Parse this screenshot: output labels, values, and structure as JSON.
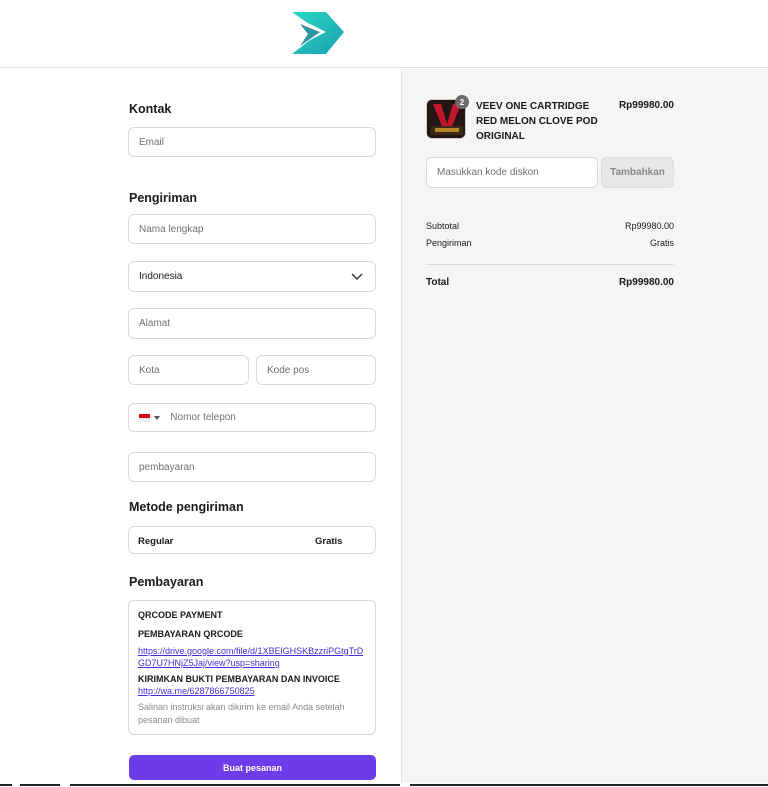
{
  "contact": {
    "title": "Kontak",
    "email_placeholder": "Email"
  },
  "shipping": {
    "title": "Pengiriman",
    "fullname_placeholder": "Nama lengkap",
    "country": "Indonesia",
    "address_placeholder": "Alamat",
    "city_placeholder": "Kota",
    "postal_placeholder": "Kode pos",
    "phone_placeholder": "Nomor telepon",
    "payment_field_placeholder": "pembayaran"
  },
  "shipping_method": {
    "title": "Metode pengiriman",
    "name": "Regular",
    "price": "Gratis"
  },
  "payment": {
    "title": "Pembayaran",
    "method": "QRCODE PAYMENT",
    "qr_heading": "PEMBAYARAN QRCODE",
    "qr_link": "https://drive.google.com/file/d/1XBElGHSKBzzriPGtgTrDGD7U7HNjZ5Jaj/view?usp=sharing",
    "proof_heading": "KIRIMKAN BUKTI PEMBAYARAN DAN INVOICE",
    "wa_link": "http://wa.me/6287866750825",
    "note": "Salinan instruksi akan dikirim ke email Anda setelah pesanan dibuat"
  },
  "submit_label": "Buat pesanan",
  "cart": {
    "product_name": "VEEV ONE CARTRIDGE RED MELON CLOVE POD ORIGINAL",
    "quantity": "2",
    "product_price": "Rp99980.00",
    "discount_placeholder": "Masukkan kode diskon",
    "apply_label": "Tambahkan",
    "subtotal_label": "Subtotal",
    "subtotal_value": "Rp99980.00",
    "shipping_label": "Pengiriman",
    "shipping_value": "Gratis",
    "total_label": "Total",
    "total_value": "Rp99980.00"
  },
  "colors": {
    "accent": "#6c3ce8",
    "logo_teal": "#1fc8b8",
    "link": "#4b2bd6"
  }
}
